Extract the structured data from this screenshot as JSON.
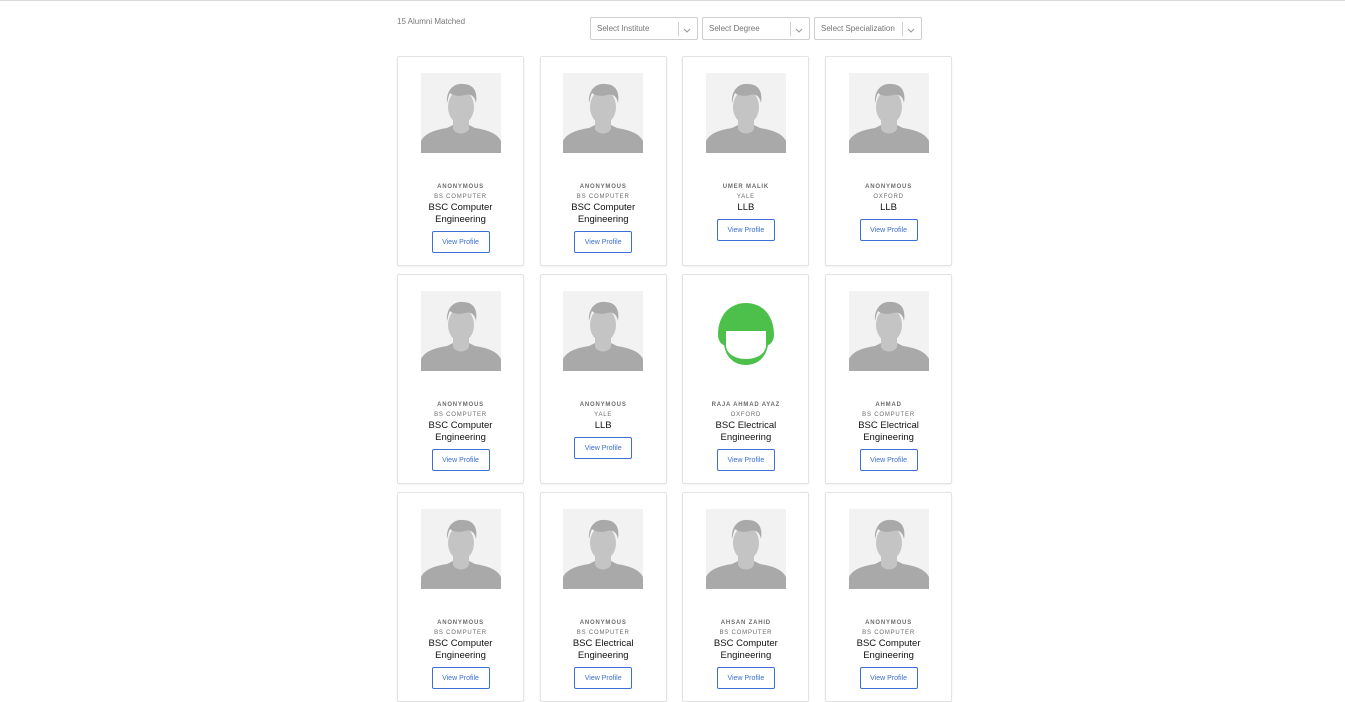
{
  "header": {
    "matched_text": "15 Alumni Matched"
  },
  "filters": {
    "institute_placeholder": "Select Institute",
    "degree_placeholder": "Select Degree",
    "specialization_placeholder": "Select Specialization"
  },
  "cards": [
    {
      "name": "ANONYMOUS",
      "institute": "BS COMPUTER",
      "specialization": "BSC Computer Engineering",
      "button": "View Profile",
      "avatar": "default-avatar-icon"
    },
    {
      "name": "ANONYMOUS",
      "institute": "BS COMPUTER",
      "specialization": "BSC Computer Engineering",
      "button": "View Profile",
      "avatar": "default-avatar-icon"
    },
    {
      "name": "UMER MALIK",
      "institute": "YALE",
      "specialization": "LLB",
      "button": "View Profile",
      "avatar": "default-avatar-icon"
    },
    {
      "name": "ANONYMOUS",
      "institute": "OXFORD",
      "specialization": "LLB",
      "button": "View Profile",
      "avatar": "default-avatar-icon"
    },
    {
      "name": "ANONYMOUS",
      "institute": "BS COMPUTER",
      "specialization": "BSC Computer Engineering",
      "button": "View Profile",
      "avatar": "default-avatar-icon"
    },
    {
      "name": "ANONYMOUS",
      "institute": "YALE",
      "specialization": "LLB",
      "button": "View Profile",
      "avatar": "default-avatar-icon"
    },
    {
      "name": "RAJA AHMAD AYAZ",
      "institute": "OXFORD",
      "specialization": "BSC Electrical Engineering",
      "button": "View Profile",
      "avatar": "green-helmet-avatar-icon"
    },
    {
      "name": "AHMAD",
      "institute": "BS COMPUTER",
      "specialization": "BSC Electrical Engineering",
      "button": "View Profile",
      "avatar": "default-avatar-icon"
    },
    {
      "name": "ANONYMOUS",
      "institute": "BS COMPUTER",
      "specialization": "BSC Computer Engineering",
      "button": "View Profile",
      "avatar": "default-avatar-icon"
    },
    {
      "name": "ANONYMOUS",
      "institute": "BS COMPUTER",
      "specialization": "BSC Electrical Engineering",
      "button": "View Profile",
      "avatar": "default-avatar-icon"
    },
    {
      "name": "AHSAN ZAHID",
      "institute": "BS COMPUTER",
      "specialization": "BSC Computer Engineering",
      "button": "View Profile",
      "avatar": "default-avatar-icon"
    },
    {
      "name": "ANONYMOUS",
      "institute": "BS COMPUTER",
      "specialization": "BSC Computer Engineering",
      "button": "View Profile",
      "avatar": "default-avatar-icon"
    }
  ],
  "colors": {
    "accent": "#3b6fd1",
    "avatar_bg": "#f2f2f2",
    "avatar_fg": "#a9a9a9",
    "green_avatar": "#4cc04a"
  }
}
